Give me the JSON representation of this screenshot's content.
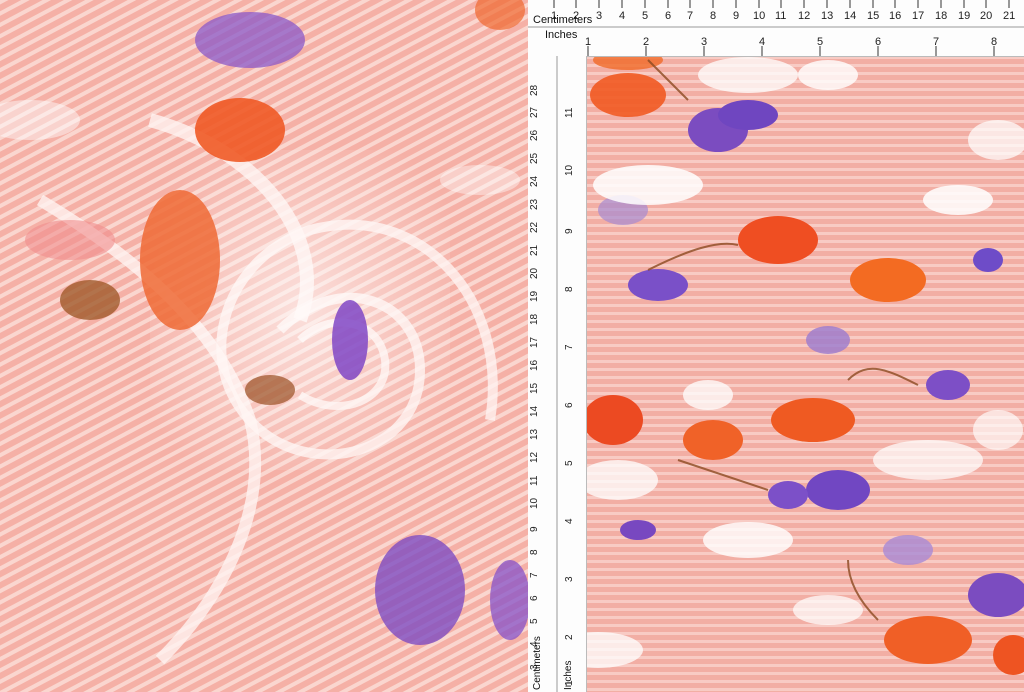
{
  "image": {
    "subject": "pleated floral fabric swatch",
    "palette": {
      "base_pink": "#f4b3a9",
      "pleat_light": "#f9d2cb",
      "orange_flower": "#ef5a26",
      "purple_flower": "#7b4cc0",
      "brown_leaf": "#8b4a20",
      "white_accent": "#ffffff"
    }
  },
  "rulers": {
    "top_title": "Centimeters",
    "top_sub": "Inches",
    "side_title": "Centimeters",
    "side_sub": "Inches"
  }
}
